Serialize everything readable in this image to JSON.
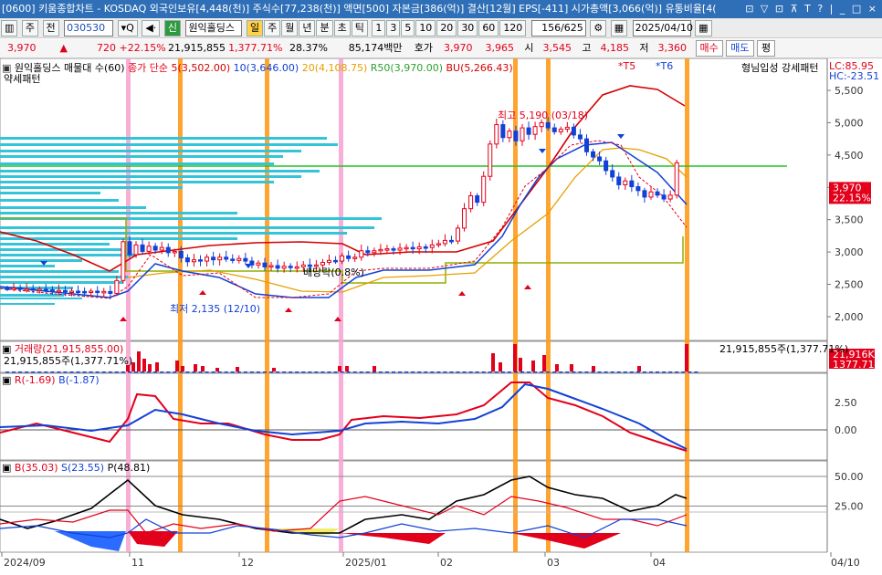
{
  "titlebar": {
    "text": "[0600] 키움종합차트 - KOSDAQ 외국인보유[4,448(천)] 주식수[77,238(천)] 액면[500] 자본금[386(억)] 결산[12월] EPS[-411] 시가총액[3,066(억)] 유통비율[4(",
    "controls": "⊡ ▽ ⊡ ⊼ T ? | _ □ ×"
  },
  "toolbar": {
    "menu": "주",
    "jeon": "전",
    "code": "030530",
    "stock_name": "원익홀딩스",
    "periods": [
      "일",
      "주",
      "월",
      "년",
      "분",
      "초",
      "틱"
    ],
    "selected_period": "일",
    "minutes": [
      "1",
      "3",
      "5",
      "10",
      "20",
      "30",
      "60",
      "120"
    ],
    "count": "156/625",
    "date": "2025/04/10"
  },
  "quote": {
    "price": "3,970",
    "change": "720",
    "change_pct": "+22.15%",
    "volume": "21,915,855",
    "vol_pct": "1,377.71%",
    "turnover": "28.37%",
    "amount": "85,174백만",
    "hoga_label": "호가",
    "ask": "3,970",
    "bid": "3,965",
    "open_label": "시",
    "open": "3,545",
    "high_label": "고",
    "high": "4,185",
    "low_label": "저",
    "low": "3,360",
    "buy": "매수",
    "sell": "매도",
    "avg": "평"
  },
  "price_panel": {
    "title": "원익홀딩스 매물대 수(60)",
    "subtitle": "약세패턴",
    "ma_label": "종가 단순",
    "ma5": "5(3,502.00)",
    "ma10": "10(3,646.00)",
    "ma20": "20(4,108.75)",
    "r50": "R50(3,970.00)",
    "bu": "BU(5,266.43)",
    "t5": "*T5",
    "t6": "*T6",
    "right_note": "형님입성 강세패턴",
    "lc": "LC:85.95",
    "hc": "HC:-23.51",
    "high_annot": "최고 5,190 (03/18)",
    "low_annot": "최저 2,135 (12/10)",
    "dividend": "배당락(0.8%)",
    "y_ticks": [
      "5,500",
      "5,000",
      "4,500",
      "4,000",
      "3,500",
      "3,000",
      "2,500",
      "2,000"
    ],
    "price_tag": "3,970",
    "pct_tag": "22.15%"
  },
  "volume_panel": {
    "title": "거래량(21,915,855.00)",
    "left_val": "21,915,855주(1,377.71%)",
    "right_val": "21,915,855주(1,377.71%)",
    "tag1": "21,916K",
    "tag2": "1377.71%"
  },
  "rb_panel": {
    "r_label": "R(-1.69)",
    "b_label": "B(-1.87)",
    "y_ticks": [
      "2.50",
      "0.00"
    ]
  },
  "bsp_panel": {
    "b_label": "B(35.03)",
    "s_label": "S(23.55)",
    "p_label": "P(48.81)",
    "y_ticks": [
      "50.00",
      "25.00"
    ]
  },
  "x_axis": [
    "2024/09",
    "11",
    "12",
    "2025/01",
    "02",
    "03",
    "04",
    "04/10"
  ],
  "colors": {
    "up": "#e3001b",
    "down": "#1241d6",
    "ma5": "#d40000",
    "ma20": "#e6a000",
    "hline": "#22c422",
    "vband": "#ff9a1a",
    "pband": "#f7a6d1"
  }
}
